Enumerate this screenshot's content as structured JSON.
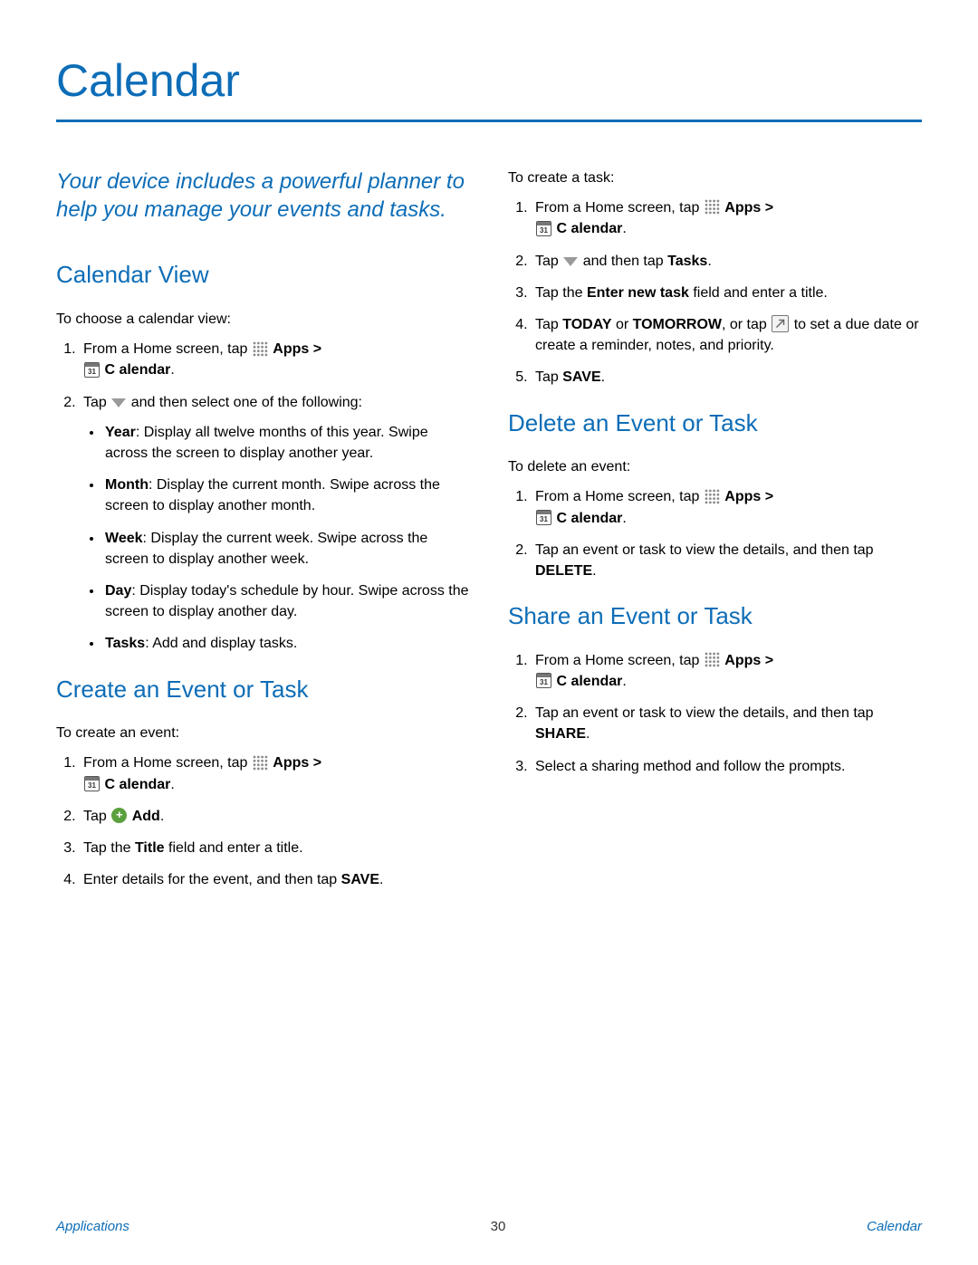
{
  "page": {
    "title": "Calendar",
    "intro": "Your device includes a powerful planner to help you manage your events and tasks."
  },
  "icons": {
    "calendar_day": "31"
  },
  "calendarView": {
    "heading": "Calendar View",
    "lead": "To choose a calendar view:",
    "step1a": "From a Home screen, tap ",
    "apps": "Apps >",
    "calendar": "C alendar",
    "period1": ".",
    "step2a": "Tap ",
    "step2b": " and then select one of the following:",
    "bullets": {
      "year_b": "Year",
      "year": ": Display all twelve months of this year. Swipe across the screen to display another year.",
      "month_b": "Month",
      "month": ": Display the current month. Swipe across the screen to display another month.",
      "week_b": "Week",
      "week": ": Display the current week. Swipe across the screen to display another week.",
      "day_b": "Day",
      "day": ": Display today's schedule by hour. Swipe across the screen to display another day.",
      "tasks_b": "Tasks",
      "tasks": ": Add and display tasks."
    }
  },
  "createEvent": {
    "heading": "Create an Event or Task",
    "leadEvent": "To create an event:",
    "step1a": "From a Home screen, tap ",
    "apps": "Apps >",
    "calendar": "C alendar",
    "period1": ".",
    "step2a": "Tap ",
    "add": "Add",
    "period2": ".",
    "step3a": "Tap the ",
    "step3b": "Title",
    "step3c": " field and enter a title.",
    "step4a": "Enter details for the event, and then tap ",
    "step4b": "SAVE",
    "period4": "."
  },
  "createTask": {
    "lead": "To create a task:",
    "step1a": "From a Home screen, tap ",
    "apps": "Apps >",
    "calendar": "C alendar",
    "period1": ".",
    "step2a": "Tap ",
    "step2b": " and then tap ",
    "step2c": "Tasks",
    "period2": ".",
    "step3a": "Tap the ",
    "step3b": "Enter new task",
    "step3c": " field and enter a title.",
    "step4a": "Tap ",
    "step4b": "TODAY",
    "step4c": " or ",
    "step4d": "TOMORROW",
    "step4e": ", or tap ",
    "step4f": " to set a due date or create a reminder, notes, and priority.",
    "step5a": "Tap ",
    "step5b": "SAVE",
    "period5": "."
  },
  "deleteEvent": {
    "heading": "Delete an Event or Task",
    "lead": "To delete an event:",
    "step1a": "From a Home screen, tap ",
    "apps": "Apps >",
    "calendar": "C alendar",
    "period1": ".",
    "step2a": "Tap an event or task to view the details, and then tap ",
    "step2b": "DELETE",
    "period2": "."
  },
  "shareEvent": {
    "heading": "Share an Event or Task",
    "step1a": "From a Home screen, tap ",
    "apps": "Apps >",
    "calendar": "C alendar",
    "period1": ".",
    "step2a": "Tap an event or task to view the details, and then tap ",
    "step2b": "SHARE",
    "period2": ".",
    "step3": "Select a sharing method and follow the prompts."
  },
  "footer": {
    "left": "Applications",
    "page": "30",
    "right": "Calendar"
  }
}
